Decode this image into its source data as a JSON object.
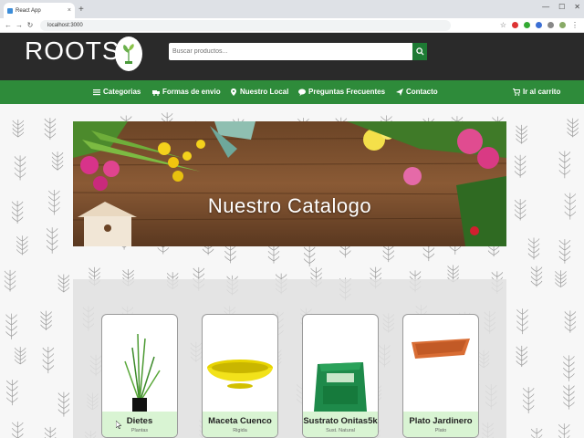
{
  "browser": {
    "tab_title": "React App",
    "url": "localhost:3000"
  },
  "header": {
    "logo": "ROOTS",
    "search_placeholder": "Buscar productos..."
  },
  "nav": {
    "categorias": "Categorias",
    "formas_envio": "Formas de envio",
    "nuestro_local": "Nuestro Local",
    "preguntas": "Preguntas Frecuentes",
    "contacto": "Contacto",
    "carrito": "Ir al carrito"
  },
  "banner": {
    "title": "Nuestro Catalogo"
  },
  "products": [
    {
      "name": "Dietes",
      "category": "Plantas"
    },
    {
      "name": "Maceta Cuenco",
      "category": "Rigida"
    },
    {
      "name": "Sustrato Onitas5k",
      "category": "Sust. Natural"
    },
    {
      "name": "Plato Jardinero",
      "category": "Plato"
    }
  ],
  "colors": {
    "header_bg": "#2a2a2a",
    "nav_green": "#2e8b3a",
    "card_footer": "#d9f4d3"
  }
}
